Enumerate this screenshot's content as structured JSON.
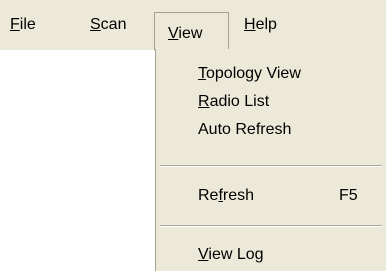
{
  "menubar": {
    "items": [
      {
        "pre": "",
        "acc": "F",
        "post": "ile"
      },
      {
        "pre": "",
        "acc": "S",
        "post": "can"
      },
      {
        "pre": "",
        "acc": "V",
        "post": "iew"
      },
      {
        "pre": "",
        "acc": "H",
        "post": "elp"
      }
    ],
    "open_item": "View"
  },
  "view_menu": {
    "items": [
      {
        "pre": "",
        "acc": "T",
        "post": "opology View"
      },
      {
        "pre": "",
        "acc": "R",
        "post": "adio List"
      },
      {
        "pre": "Auto Refresh",
        "acc": "",
        "post": ""
      },
      {
        "pre": "Re",
        "acc": "f",
        "post": "resh",
        "shortcut": "F5"
      },
      {
        "pre": "",
        "acc": "V",
        "post": "iew Log"
      }
    ]
  },
  "colors": {
    "menu_background": "#ece9d8",
    "separator": "#aca899"
  }
}
